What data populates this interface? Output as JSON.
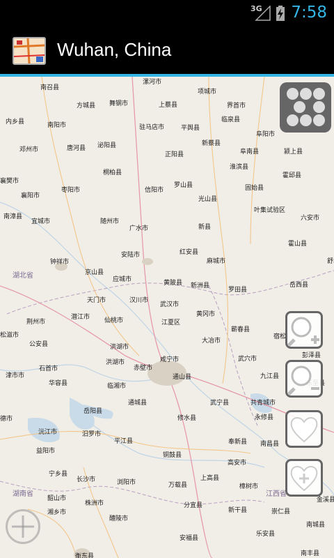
{
  "status_bar": {
    "network": "3G",
    "time": "7:58"
  },
  "action_bar": {
    "title": "Wuhan, China"
  },
  "map": {
    "labels": [
      [
        "南召县",
        58,
        118
      ],
      [
        "漯河市",
        205,
        110
      ],
      [
        "项城市",
        284,
        124
      ],
      [
        "方城县",
        110,
        144
      ],
      [
        "舞钢市",
        157,
        141
      ],
      [
        "上蔡县",
        228,
        143
      ],
      [
        "界首市",
        326,
        144
      ],
      [
        "内乡县",
        8,
        167
      ],
      [
        "南阳市",
        68,
        172
      ],
      [
        "驻马店市",
        200,
        175
      ],
      [
        "平舆县",
        260,
        176
      ],
      [
        "临泉县",
        318,
        164
      ],
      [
        "阜阳市",
        368,
        185
      ],
      [
        "邓州市",
        28,
        207
      ],
      [
        "唐河县",
        96,
        205
      ],
      [
        "泌阳县",
        140,
        201
      ],
      [
        "新蔡县",
        290,
        198
      ],
      [
        "阜南县",
        345,
        210
      ],
      [
        "颍上县",
        408,
        210
      ],
      [
        "正阳县",
        237,
        214
      ],
      [
        "桐柏县",
        148,
        240
      ],
      [
        "淮滨县",
        330,
        232
      ],
      [
        "霍邱县",
        406,
        244
      ],
      [
        "襄樊市",
        0,
        252
      ],
      [
        "罗山县",
        250,
        258
      ],
      [
        "枣阳市",
        88,
        265
      ],
      [
        "信阳市",
        208,
        265
      ],
      [
        "固始县",
        352,
        262
      ],
      [
        "光山县",
        285,
        278
      ],
      [
        "襄阳市",
        30,
        273
      ],
      [
        "叶集试验区",
        365,
        294
      ],
      [
        "南漳县",
        5,
        303
      ],
      [
        "宜城市",
        45,
        310
      ],
      [
        "随州市",
        144,
        310
      ],
      [
        "广水市",
        186,
        320
      ],
      [
        "六安市",
        432,
        305
      ],
      [
        "新县",
        285,
        318
      ],
      [
        "霍山县",
        414,
        342
      ],
      [
        "安陆市",
        174,
        358
      ],
      [
        "红安县",
        258,
        354
      ],
      [
        "麻城市",
        297,
        367
      ],
      [
        "钟祥市",
        72,
        368
      ],
      [
        "京山县",
        122,
        383
      ],
      [
        "舒城县",
        470,
        367
      ],
      [
        "湖北省",
        18,
        386
      ],
      [
        "应城市",
        162,
        393
      ],
      [
        "黄陂县",
        235,
        398
      ],
      [
        "新洲县",
        274,
        402
      ],
      [
        "罗田县",
        328,
        408
      ],
      [
        "岳西县",
        416,
        401
      ],
      [
        "天门市",
        125,
        423
      ],
      [
        "汉川市",
        186,
        423
      ],
      [
        "武汉市",
        230,
        429
      ],
      [
        "黄冈市",
        282,
        443
      ],
      [
        "荆州市",
        38,
        454
      ],
      [
        "潜江市",
        102,
        447
      ],
      [
        "仙桃市",
        150,
        452
      ],
      [
        "江夏区",
        232,
        455
      ],
      [
        "蕲春县",
        332,
        465
      ],
      [
        "宿松",
        393,
        475
      ],
      [
        "松滋市",
        0,
        473
      ],
      [
        "大冶市",
        290,
        481
      ],
      [
        "公安县",
        42,
        486
      ],
      [
        "洪湖市",
        158,
        490
      ],
      [
        "彭泽县",
        434,
        502
      ],
      [
        "石首市",
        56,
        521
      ],
      [
        "洪湖市",
        152,
        512
      ],
      [
        "赤壁市",
        192,
        520
      ],
      [
        "咸宁市",
        230,
        508
      ],
      [
        "武穴市",
        342,
        507
      ],
      [
        "津市市",
        8,
        531
      ],
      [
        "华容县",
        70,
        542
      ],
      [
        "临湘市",
        154,
        546
      ],
      [
        "通山县",
        248,
        533
      ],
      [
        "九江县",
        374,
        532
      ],
      [
        "东至县",
        440,
        542
      ],
      [
        "通城县",
        184,
        570
      ],
      [
        "武宁县",
        302,
        570
      ],
      [
        "共青城市",
        360,
        570
      ],
      [
        "岳阳县",
        120,
        582
      ],
      [
        "修水县",
        255,
        592
      ],
      [
        "永修县",
        366,
        591
      ],
      [
        "德市",
        0,
        593
      ],
      [
        "汨罗市",
        118,
        615
      ],
      [
        "沅江市",
        55,
        612
      ],
      [
        "平江县",
        164,
        625
      ],
      [
        "奉新县",
        328,
        626
      ],
      [
        "南昌县",
        374,
        629
      ],
      [
        "益阳市",
        52,
        639
      ],
      [
        "铜鼓县",
        234,
        645
      ],
      [
        "高安市",
        327,
        656
      ],
      [
        "宁乡县",
        70,
        672
      ],
      [
        "长沙市",
        110,
        680
      ],
      [
        "浏阳市",
        168,
        684
      ],
      [
        "万载县",
        242,
        688
      ],
      [
        "上高县",
        288,
        678
      ],
      [
        "樟树市",
        344,
        690
      ],
      [
        "江西省",
        382,
        699
      ],
      [
        "湖南省",
        18,
        699
      ],
      [
        "韶山市",
        68,
        707
      ],
      [
        "株洲市",
        122,
        714
      ],
      [
        "分宜县",
        264,
        717
      ],
      [
        "新干县",
        328,
        724
      ],
      [
        "崇仁县",
        390,
        726
      ],
      [
        "金溪县",
        455,
        709
      ],
      [
        "湘乡市",
        68,
        727
      ],
      [
        "醴陵市",
        157,
        736
      ],
      [
        "安福县",
        258,
        764
      ],
      [
        "乐安县",
        368,
        758
      ],
      [
        "南城县",
        440,
        745
      ],
      [
        "衡东县",
        108,
        790
      ],
      [
        "南丰县",
        432,
        786
      ]
    ]
  }
}
